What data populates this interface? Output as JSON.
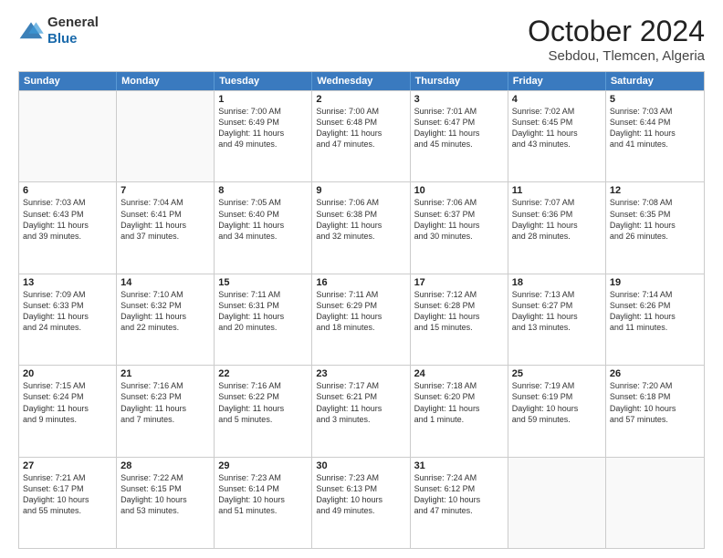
{
  "logo": {
    "general": "General",
    "blue": "Blue"
  },
  "title": "October 2024",
  "location": "Sebdou, Tlemcen, Algeria",
  "header_days": [
    "Sunday",
    "Monday",
    "Tuesday",
    "Wednesday",
    "Thursday",
    "Friday",
    "Saturday"
  ],
  "weeks": [
    [
      {
        "day": "",
        "empty": true
      },
      {
        "day": "",
        "empty": true
      },
      {
        "day": "1",
        "sunrise": "7:00 AM",
        "sunset": "6:49 PM",
        "daylight": "11 hours and 49 minutes."
      },
      {
        "day": "2",
        "sunrise": "7:00 AM",
        "sunset": "6:48 PM",
        "daylight": "11 hours and 47 minutes."
      },
      {
        "day": "3",
        "sunrise": "7:01 AM",
        "sunset": "6:47 PM",
        "daylight": "11 hours and 45 minutes."
      },
      {
        "day": "4",
        "sunrise": "7:02 AM",
        "sunset": "6:45 PM",
        "daylight": "11 hours and 43 minutes."
      },
      {
        "day": "5",
        "sunrise": "7:03 AM",
        "sunset": "6:44 PM",
        "daylight": "11 hours and 41 minutes."
      }
    ],
    [
      {
        "day": "6",
        "sunrise": "7:03 AM",
        "sunset": "6:43 PM",
        "daylight": "11 hours and 39 minutes."
      },
      {
        "day": "7",
        "sunrise": "7:04 AM",
        "sunset": "6:41 PM",
        "daylight": "11 hours and 37 minutes."
      },
      {
        "day": "8",
        "sunrise": "7:05 AM",
        "sunset": "6:40 PM",
        "daylight": "11 hours and 34 minutes."
      },
      {
        "day": "9",
        "sunrise": "7:06 AM",
        "sunset": "6:38 PM",
        "daylight": "11 hours and 32 minutes."
      },
      {
        "day": "10",
        "sunrise": "7:06 AM",
        "sunset": "6:37 PM",
        "daylight": "11 hours and 30 minutes."
      },
      {
        "day": "11",
        "sunrise": "7:07 AM",
        "sunset": "6:36 PM",
        "daylight": "11 hours and 28 minutes."
      },
      {
        "day": "12",
        "sunrise": "7:08 AM",
        "sunset": "6:35 PM",
        "daylight": "11 hours and 26 minutes."
      }
    ],
    [
      {
        "day": "13",
        "sunrise": "7:09 AM",
        "sunset": "6:33 PM",
        "daylight": "11 hours and 24 minutes."
      },
      {
        "day": "14",
        "sunrise": "7:10 AM",
        "sunset": "6:32 PM",
        "daylight": "11 hours and 22 minutes."
      },
      {
        "day": "15",
        "sunrise": "7:11 AM",
        "sunset": "6:31 PM",
        "daylight": "11 hours and 20 minutes."
      },
      {
        "day": "16",
        "sunrise": "7:11 AM",
        "sunset": "6:29 PM",
        "daylight": "11 hours and 18 minutes."
      },
      {
        "day": "17",
        "sunrise": "7:12 AM",
        "sunset": "6:28 PM",
        "daylight": "11 hours and 15 minutes."
      },
      {
        "day": "18",
        "sunrise": "7:13 AM",
        "sunset": "6:27 PM",
        "daylight": "11 hours and 13 minutes."
      },
      {
        "day": "19",
        "sunrise": "7:14 AM",
        "sunset": "6:26 PM",
        "daylight": "11 hours and 11 minutes."
      }
    ],
    [
      {
        "day": "20",
        "sunrise": "7:15 AM",
        "sunset": "6:24 PM",
        "daylight": "11 hours and 9 minutes."
      },
      {
        "day": "21",
        "sunrise": "7:16 AM",
        "sunset": "6:23 PM",
        "daylight": "11 hours and 7 minutes."
      },
      {
        "day": "22",
        "sunrise": "7:16 AM",
        "sunset": "6:22 PM",
        "daylight": "11 hours and 5 minutes."
      },
      {
        "day": "23",
        "sunrise": "7:17 AM",
        "sunset": "6:21 PM",
        "daylight": "11 hours and 3 minutes."
      },
      {
        "day": "24",
        "sunrise": "7:18 AM",
        "sunset": "6:20 PM",
        "daylight": "11 hours and 1 minute."
      },
      {
        "day": "25",
        "sunrise": "7:19 AM",
        "sunset": "6:19 PM",
        "daylight": "10 hours and 59 minutes."
      },
      {
        "day": "26",
        "sunrise": "7:20 AM",
        "sunset": "6:18 PM",
        "daylight": "10 hours and 57 minutes."
      }
    ],
    [
      {
        "day": "27",
        "sunrise": "7:21 AM",
        "sunset": "6:17 PM",
        "daylight": "10 hours and 55 minutes."
      },
      {
        "day": "28",
        "sunrise": "7:22 AM",
        "sunset": "6:15 PM",
        "daylight": "10 hours and 53 minutes."
      },
      {
        "day": "29",
        "sunrise": "7:23 AM",
        "sunset": "6:14 PM",
        "daylight": "10 hours and 51 minutes."
      },
      {
        "day": "30",
        "sunrise": "7:23 AM",
        "sunset": "6:13 PM",
        "daylight": "10 hours and 49 minutes."
      },
      {
        "day": "31",
        "sunrise": "7:24 AM",
        "sunset": "6:12 PM",
        "daylight": "10 hours and 47 minutes."
      },
      {
        "day": "",
        "empty": true
      },
      {
        "day": "",
        "empty": true
      }
    ]
  ]
}
